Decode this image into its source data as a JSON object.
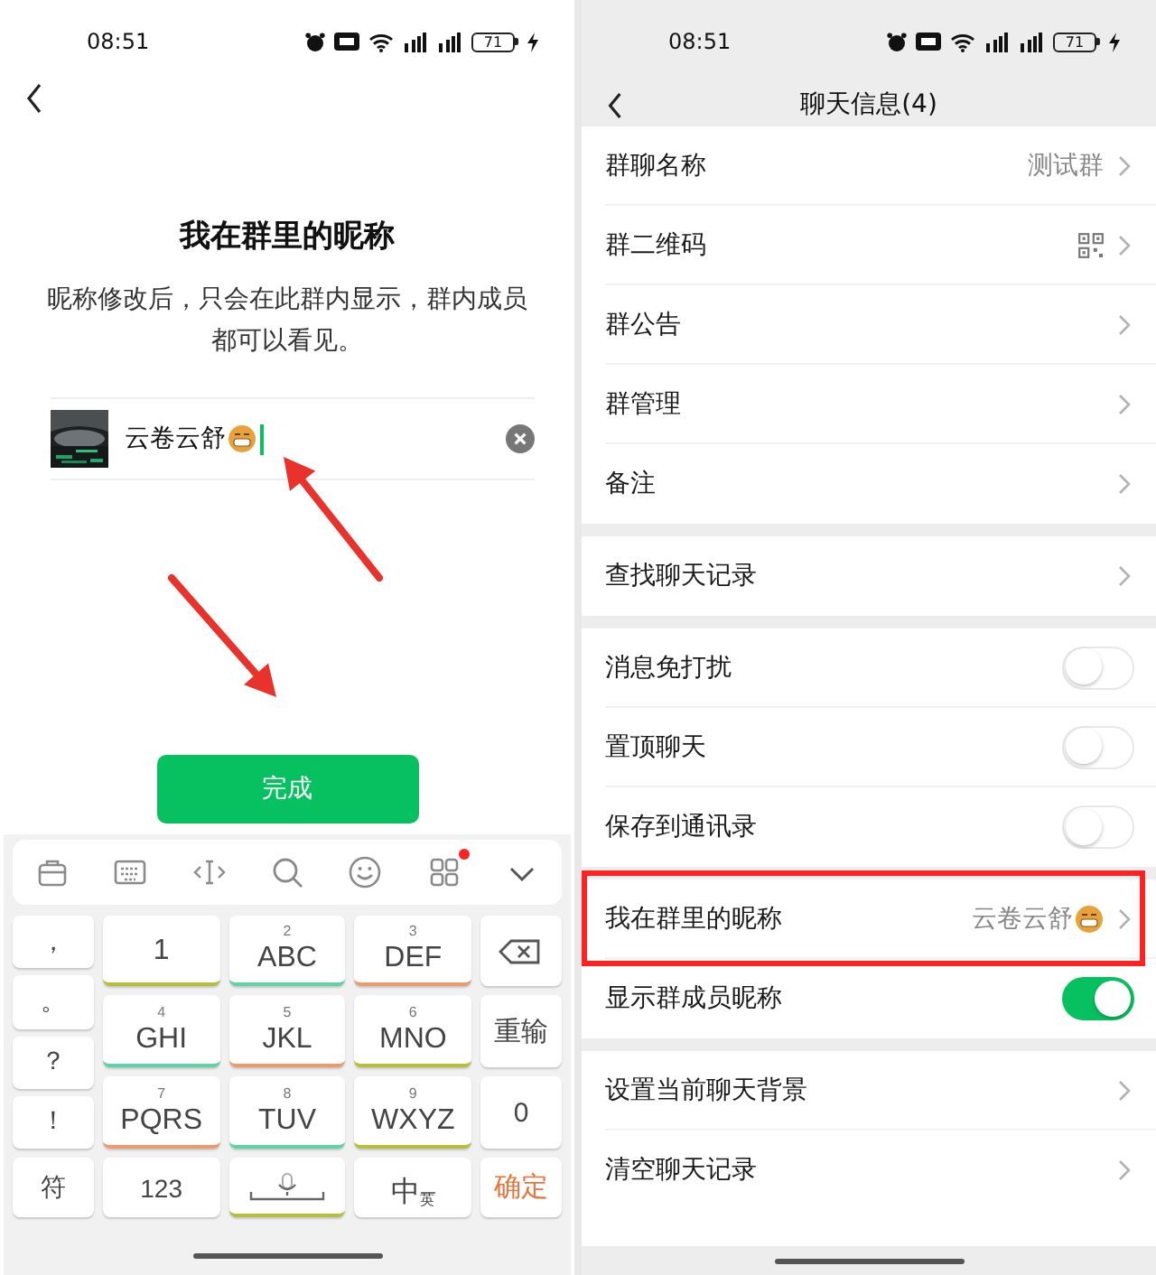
{
  "edit_screen": {
    "status_bar": {
      "time": "08:51",
      "battery": "71"
    },
    "title": "我在群里的昵称",
    "description": "昵称修改后，只会在此群内显示，群内成员都可以看见。",
    "nickname_field": {
      "value": "云卷云舒"
    },
    "done_button": "完成",
    "keyboard": {
      "toolbar_badge": true,
      "symbol_keys": [
        "，",
        "。",
        "？",
        "！"
      ],
      "key_rows": [
        [
          {
            "letters": "1",
            "color": "#b5bf3a"
          },
          {
            "number": "2",
            "letters": "ABC",
            "color": "#5ed4a6"
          },
          {
            "number": "3",
            "letters": "DEF",
            "color": "#ee9a6c"
          }
        ],
        [
          {
            "number": "4",
            "letters": "GHI",
            "color": "#5ed4a6"
          },
          {
            "number": "5",
            "letters": "JKL",
            "color": "#ee9a6c"
          },
          {
            "number": "6",
            "letters": "MNO",
            "color": "#b5bf3a"
          }
        ],
        [
          {
            "number": "7",
            "letters": "PQRS",
            "color": "#ee9a6c"
          },
          {
            "number": "8",
            "letters": "TUV",
            "color": "#5ed4a6"
          },
          {
            "number": "9",
            "letters": "WXYZ",
            "color": "#b5bf3a"
          }
        ]
      ],
      "side_keys": [
        {
          "kind": "backspace"
        },
        {
          "kind": "text",
          "label": "重输"
        },
        {
          "kind": "text",
          "label": "0"
        }
      ],
      "bottom_keys": [
        {
          "kind": "text",
          "label": "符"
        },
        {
          "kind": "text",
          "label": "123"
        },
        {
          "kind": "space",
          "color": "#b5bf3a"
        },
        {
          "kind": "lang",
          "label": "中",
          "sub": "英"
        },
        {
          "kind": "confirm",
          "label": "确定"
        }
      ]
    }
  },
  "annotations": [
    {
      "kind": "arrow"
    },
    {
      "kind": "arrow"
    }
  ],
  "info_screen": {
    "status_bar": {
      "time": "08:51",
      "battery": "71"
    },
    "title": "聊天信息(4)",
    "sections": [
      [
        {
          "kind": "link",
          "label": "群聊名称",
          "value": "测试群",
          "highlighted": false
        },
        {
          "kind": "qr",
          "label": "群二维码",
          "highlighted": false
        },
        {
          "kind": "link",
          "label": "群公告",
          "highlighted": false
        },
        {
          "kind": "link",
          "label": "群管理",
          "highlighted": false
        },
        {
          "kind": "link",
          "label": "备注",
          "highlighted": false
        }
      ],
      [
        {
          "kind": "link",
          "label": "查找聊天记录",
          "highlighted": false
        }
      ],
      [
        {
          "kind": "toggle",
          "label": "消息免打扰",
          "on": false,
          "highlighted": false
        },
        {
          "kind": "toggle",
          "label": "置顶聊天",
          "on": false,
          "highlighted": false
        },
        {
          "kind": "toggle",
          "label": "保存到通讯录",
          "on": false,
          "highlighted": false
        }
      ],
      [
        {
          "kind": "link",
          "label": "我在群里的昵称",
          "value": "云卷云舒",
          "highlighted": true
        },
        {
          "kind": "toggle",
          "label": "显示群成员昵称",
          "on": true,
          "highlighted": false
        }
      ],
      [
        {
          "kind": "link",
          "label": "设置当前聊天背景",
          "highlighted": false
        },
        {
          "kind": "link",
          "label": "清空聊天记录",
          "highlighted": false
        }
      ]
    ]
  }
}
